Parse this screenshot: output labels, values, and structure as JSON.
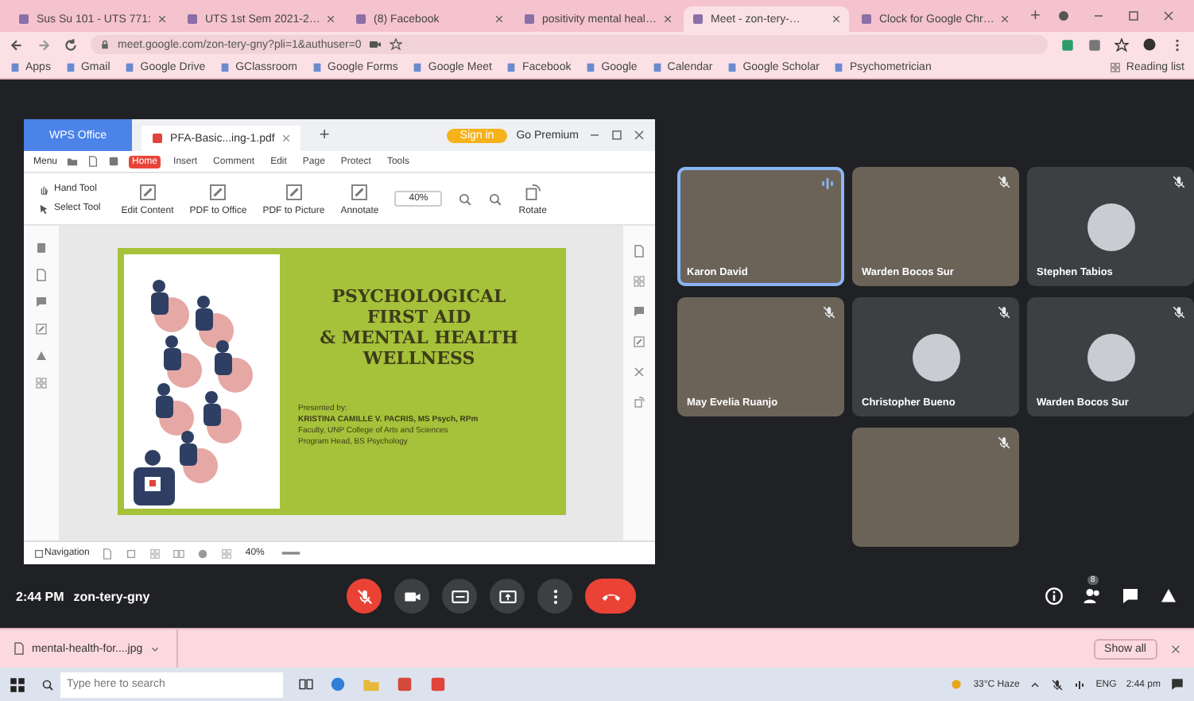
{
  "browser": {
    "tabs": [
      {
        "title": "Sus Su 101 - UTS 771:",
        "selected": false
      },
      {
        "title": "UTS 1st Sem 2021-2…",
        "selected": false
      },
      {
        "title": "(8) Facebook",
        "selected": false
      },
      {
        "title": "positivity mental heal…",
        "selected": false
      },
      {
        "title": "Meet - zon-tery-…",
        "selected": true
      },
      {
        "title": "Clock for Google Chr…",
        "selected": false
      }
    ],
    "new_tab": "+",
    "address": "meet.google.com/zon-tery-gny?pli=1&authuser=0",
    "bookmarks": [
      "Apps",
      "Gmail",
      "Google Drive",
      "GClassroom",
      "Google Forms",
      "Google Meet",
      "Facebook",
      "Google",
      "Calendar",
      "Google Scholar",
      "Psychometrician"
    ],
    "reading_list": "Reading list"
  },
  "pdf_window": {
    "app_tab": "WPS Office",
    "doc_tab": "PFA-Basic...ing-1.pdf",
    "new_tab": "+",
    "sign_in": "Sign in",
    "premium": "Go Premium",
    "menu": "Menu",
    "ribbon_tabs": [
      {
        "label": "Home",
        "selected": true
      },
      {
        "label": "Insert",
        "selected": false
      },
      {
        "label": "Comment",
        "selected": false
      },
      {
        "label": "Edit",
        "selected": false
      },
      {
        "label": "Page",
        "selected": false
      },
      {
        "label": "Protect",
        "selected": false
      },
      {
        "label": "Tools",
        "selected": false
      }
    ],
    "small_tools": [
      "Hand Tool",
      "Select Tool"
    ],
    "large_tools": [
      "Edit Content",
      "PDF to Office",
      "PDF to Picture",
      "Annotate"
    ],
    "zoom": "40%",
    "rotate": "Rotate",
    "slide": {
      "title_lines": [
        "PSYCHOLOGICAL",
        "FIRST AID",
        "& MENTAL HEALTH",
        "WELLNESS"
      ],
      "presenter_lines": [
        {
          "text": "Presented by:",
          "kind": "plain"
        },
        {
          "text": "KRISTINA CAMILLE V. PACRIS, MS Psych, RPm",
          "kind": "name"
        },
        {
          "text": "Faculty, UNP College of Arts and Sciences",
          "kind": "plain"
        },
        {
          "text": "Program Head, BS Psychology",
          "kind": "plain"
        }
      ]
    },
    "navigation": "Navigation",
    "status_zoom": "40%"
  },
  "meet": {
    "participants": [
      {
        "name": "Karon David",
        "kind": "video",
        "speaking": true,
        "muted": false
      },
      {
        "name": "Warden Bocos Sur",
        "kind": "video",
        "speaking": false,
        "muted": true
      },
      {
        "name": "Stephen Tabios",
        "kind": "avatar",
        "speaking": false,
        "muted": true
      },
      {
        "name": "May Evelia Ruanjo",
        "kind": "video",
        "speaking": false,
        "muted": true
      },
      {
        "name": "Christopher Bueno",
        "kind": "avatar",
        "speaking": false,
        "muted": true
      },
      {
        "name": "Warden Bocos Sur",
        "kind": "avatar",
        "speaking": false,
        "muted": true
      },
      {
        "kind": "video",
        "speaking": false,
        "muted": true
      }
    ],
    "time": "2:44 PM",
    "code": "zon-tery-gny",
    "people_count": "8"
  },
  "downloads": {
    "file": "mental-health-for....jpg",
    "show_all": "Show all"
  },
  "taskbar": {
    "search_placeholder": "Type here to search",
    "weather": "33°C Haze",
    "language": "ENG",
    "time": "2:44 pm"
  }
}
